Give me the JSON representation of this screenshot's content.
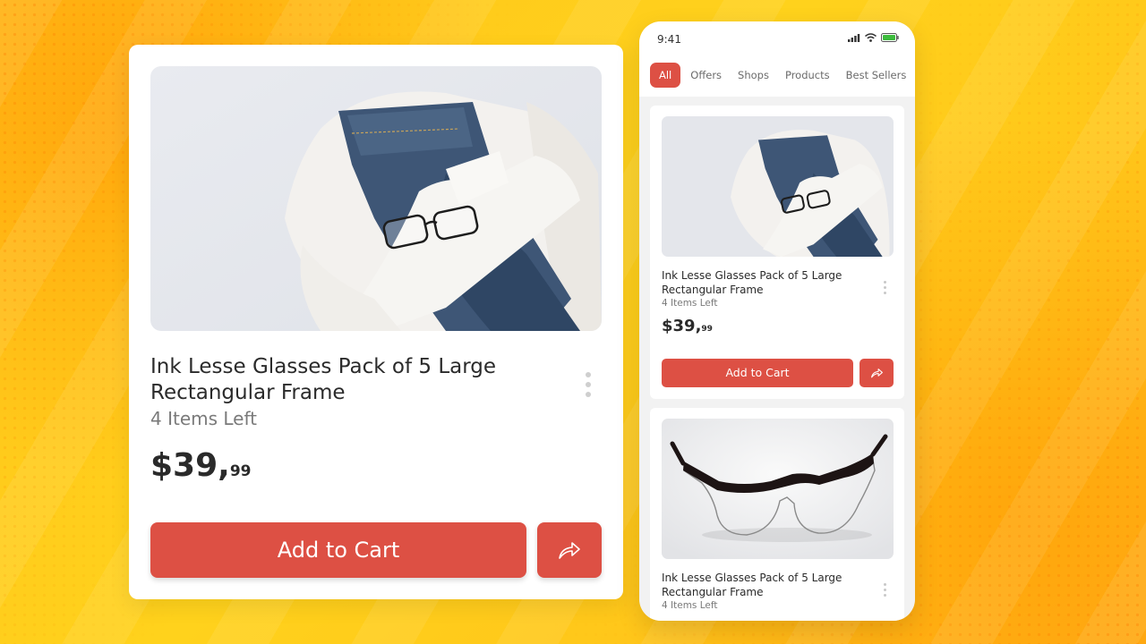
{
  "theme": {
    "accent": "#dd5044",
    "background": "#ffc71a",
    "card_bg": "#ffffff"
  },
  "featured": {
    "image_icon": "clothes-glasses-photo",
    "title": "Ink Lesse Glasses Pack of 5 Large Rectangular Frame",
    "stock": "4 Items Left",
    "price_dollars": "$39,",
    "price_cents": "99",
    "add_to_cart_label": "Add to Cart",
    "share_icon": "share-icon",
    "menu_icon": "more-vertical-icon"
  },
  "phone": {
    "status": {
      "time": "9:41",
      "icons": [
        "signal-icon",
        "wifi-icon",
        "battery-icon"
      ]
    },
    "tabs": [
      {
        "label": "All",
        "active": true
      },
      {
        "label": "Offers",
        "active": false
      },
      {
        "label": "Shops",
        "active": false
      },
      {
        "label": "Products",
        "active": false
      },
      {
        "label": "Best Sellers",
        "active": false
      }
    ],
    "products": [
      {
        "image_icon": "clothes-glasses-photo",
        "title": "Ink Lesse Glasses Pack of 5 Large Rectangular Frame",
        "stock": "4 Items Left",
        "price_dollars": "$39,",
        "price_cents": "99",
        "add_to_cart_label": "Add to Cart"
      },
      {
        "image_icon": "eyeglasses-photo",
        "title": "Ink Lesse Glasses Pack of 5 Large Rectangular Frame",
        "stock": "4 Items Left"
      }
    ]
  }
}
